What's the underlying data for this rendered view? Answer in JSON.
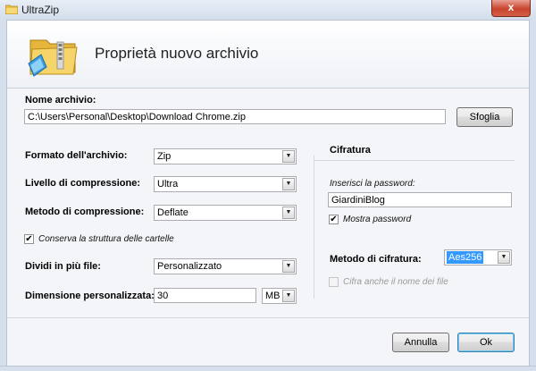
{
  "window": {
    "title": "UltraZip",
    "close_glyph": "x",
    "icon": "folder-icon"
  },
  "header": {
    "title": "Proprietà nuovo archivio",
    "icon": "zip-folder-icon"
  },
  "archive": {
    "name_label": "Nome archivio:",
    "path_value": "C:\\Users\\Personal\\Desktop\\Download Chrome.zip",
    "browse_label": "Sfoglia"
  },
  "settings": {
    "format_label": "Formato dell'archivio:",
    "format_value": "Zip",
    "level_label": "Livello di compressione:",
    "level_value": "Ultra",
    "method_label": "Metodo di compressione:",
    "method_value": "Deflate",
    "keep_structure_label": "Conserva la struttura delle cartelle",
    "keep_structure_checked": true,
    "split_label": "Dividi in più file:",
    "split_value": "Personalizzato",
    "custom_size_label": "Dimensione personalizzata:",
    "custom_size_value": "30",
    "unit_value": "MB"
  },
  "encryption": {
    "section_title": "Cifratura",
    "password_label": "Inserisci la password:",
    "password_value": "GiardiniBlog",
    "show_password_label": "Mostra password",
    "show_password_checked": true,
    "method_label": "Metodo di cifratura:",
    "method_value": "Aes256",
    "encrypt_names_label": "Cifra anche il nome dei file",
    "encrypt_names_checked": false
  },
  "footer": {
    "cancel_label": "Annulla",
    "ok_label": "Ok"
  },
  "glyphs": {
    "check": "✔",
    "dropdown": "▼"
  },
  "colors": {
    "selection": "#3399ff",
    "default_button_border": "#3c7fb1",
    "close_button": "#c7442c"
  }
}
